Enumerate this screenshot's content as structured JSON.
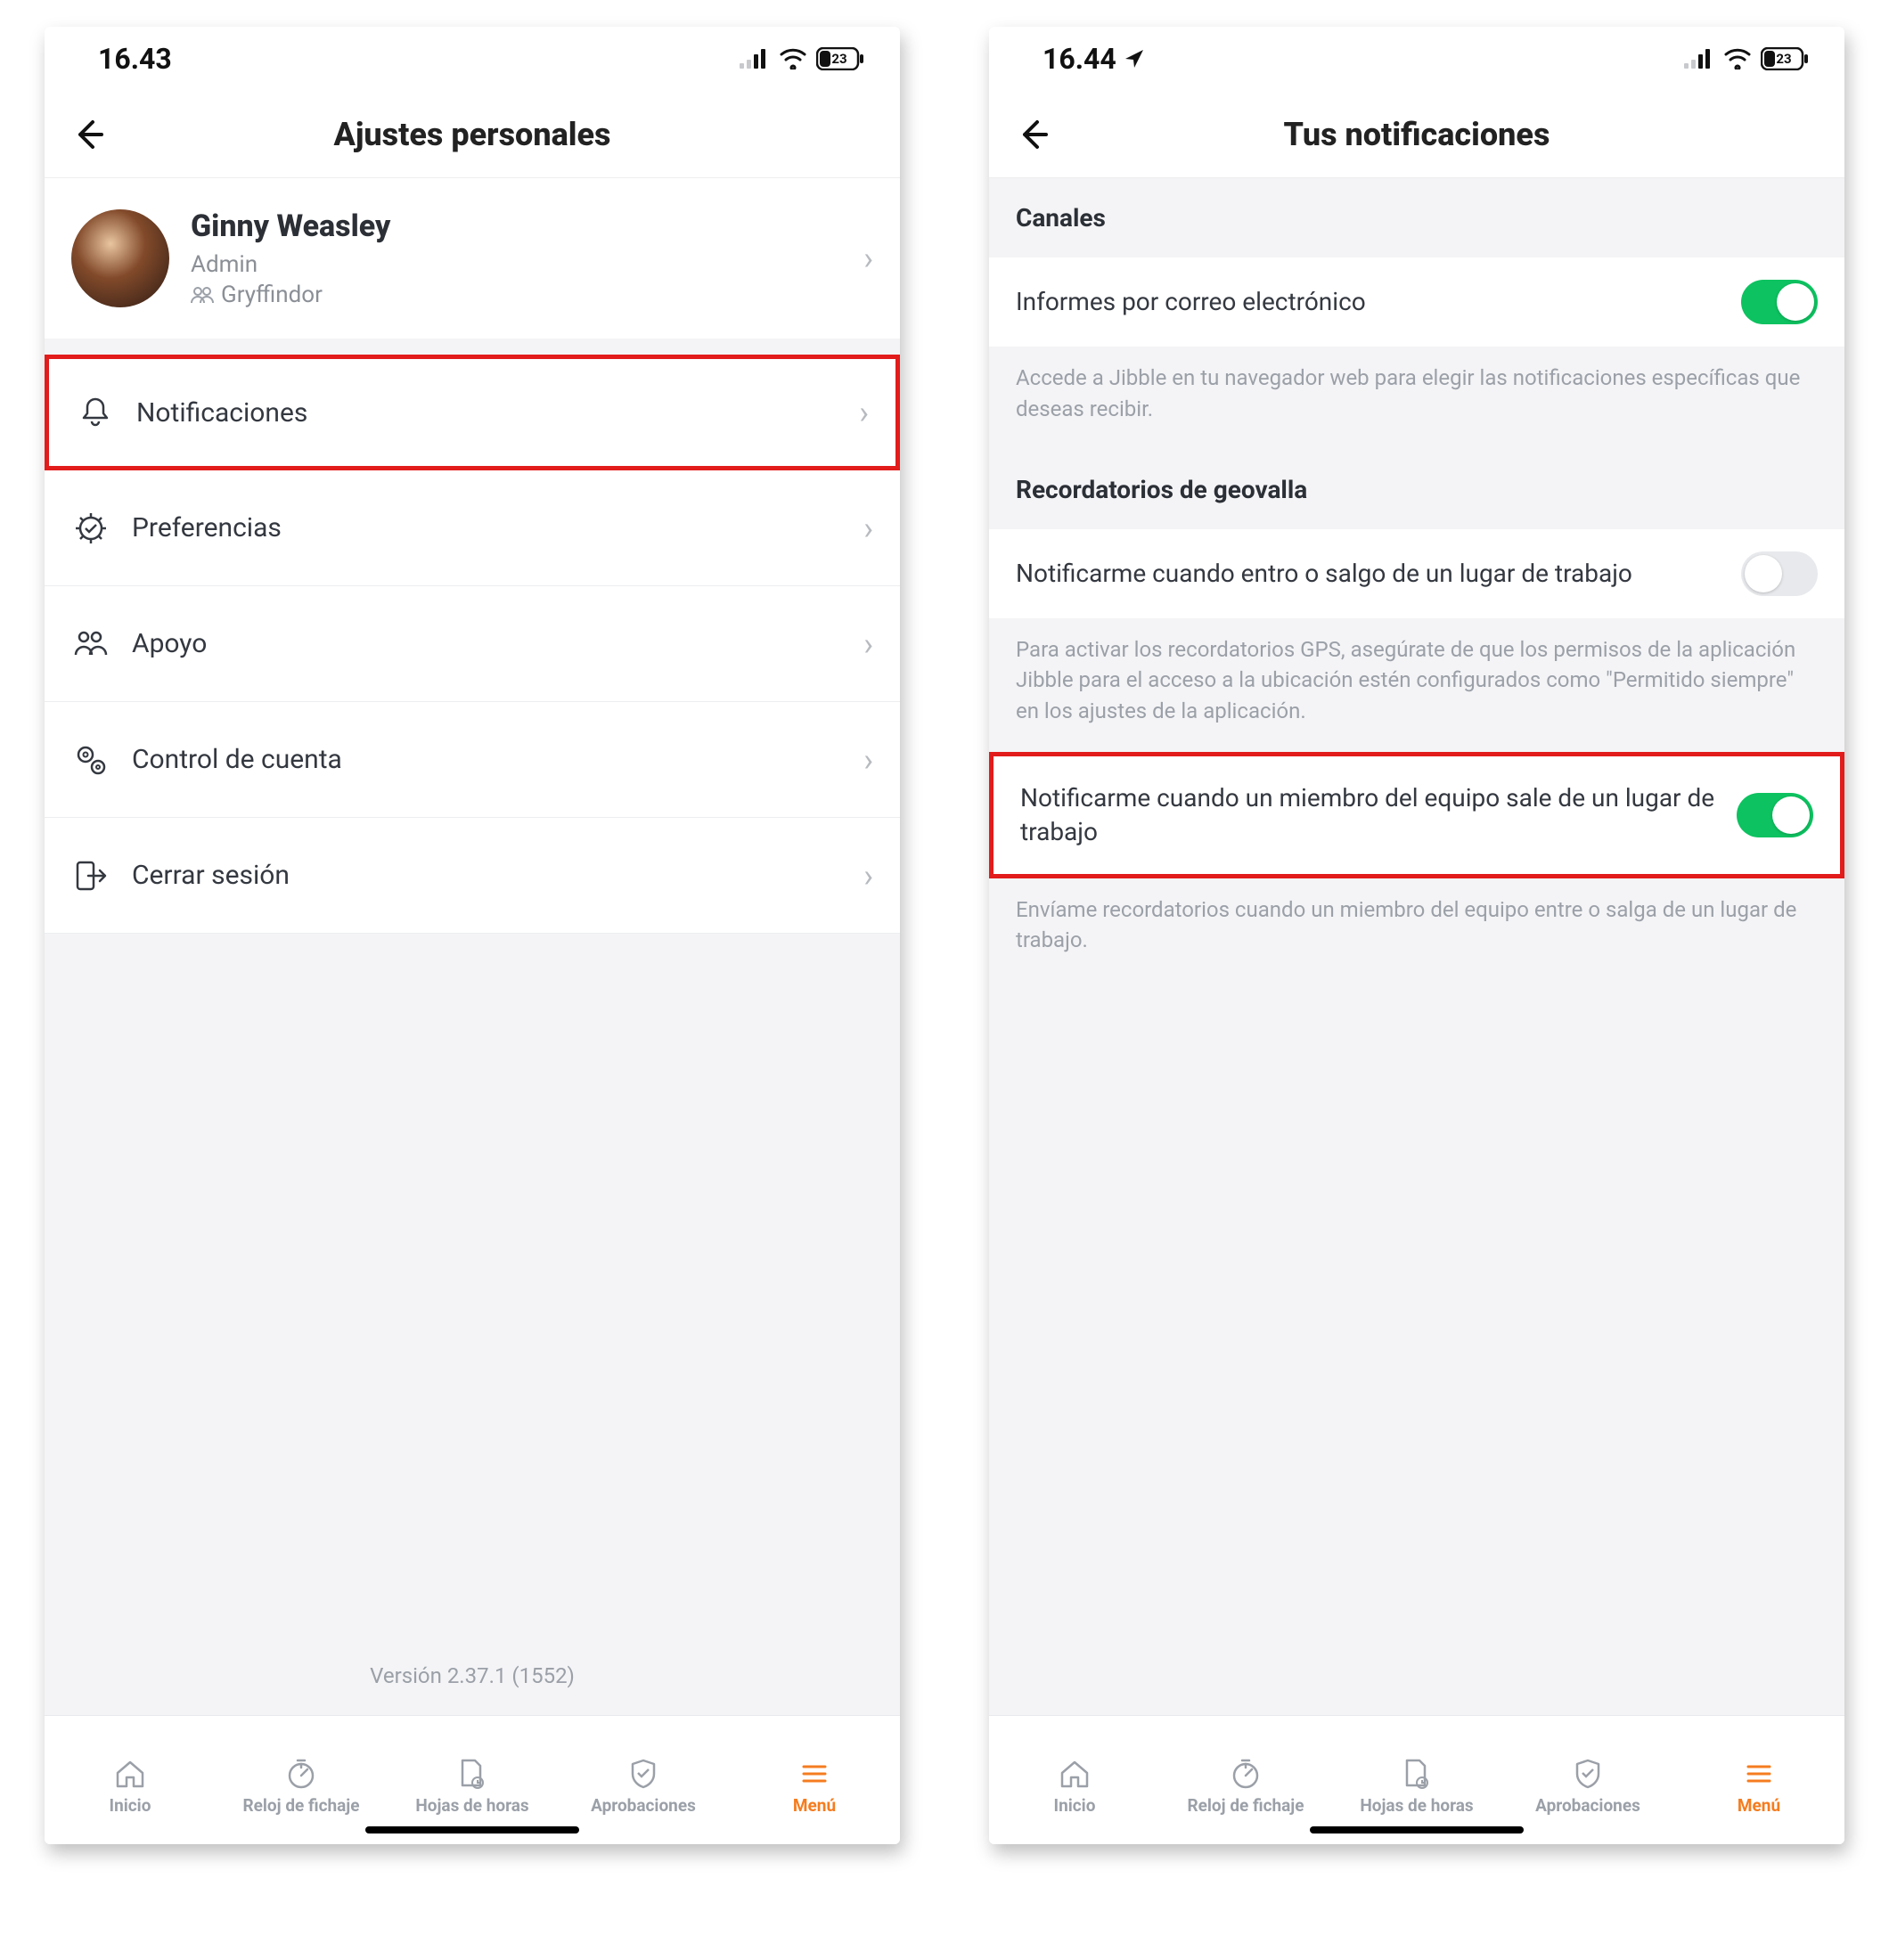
{
  "left": {
    "status": {
      "time": "16.43",
      "battery": "23"
    },
    "header": {
      "title": "Ajustes personales"
    },
    "profile": {
      "name": "Ginny Weasley",
      "role": "Admin",
      "house": "Gryffindor"
    },
    "menu": {
      "notifications": "Notificaciones",
      "preferences": "Preferencias",
      "support": "Apoyo",
      "account": "Control de cuenta",
      "logout": "Cerrar sesión"
    },
    "version": "Versión 2.37.1 (1552)"
  },
  "right": {
    "status": {
      "time": "16.44",
      "battery": "23"
    },
    "header": {
      "title": "Tus notificaciones"
    },
    "sections": {
      "channels_title": "Canales",
      "email_reports": "Informes por correo electrónico",
      "email_helper": "Accede a Jibble en tu navegador web para elegir las notificaciones específicas que deseas recibir.",
      "geofence_title": "Recordatorios de geovalla",
      "geofence_self": "Notificarme cuando entro o salgo de un lugar de trabajo",
      "geofence_helper": "Para activar los recordatorios GPS, asegúrate de que los permisos de la aplicación Jibble para el acceso a la ubicación estén configurados como \"Permitido siempre\" en los ajustes de la aplicación.",
      "geofence_team": "Notificarme cuando un miembro del equipo sale de un lugar de trabajo",
      "geofence_team_helper": "Envíame recordatorios cuando un miembro del equipo entre o salga de un lugar de trabajo."
    }
  },
  "tabs": {
    "home": "Inicio",
    "clock": "Reloj de fichaje",
    "timesheets": "Hojas de horas",
    "approvals": "Aprobaciones",
    "menu": "Menú"
  }
}
